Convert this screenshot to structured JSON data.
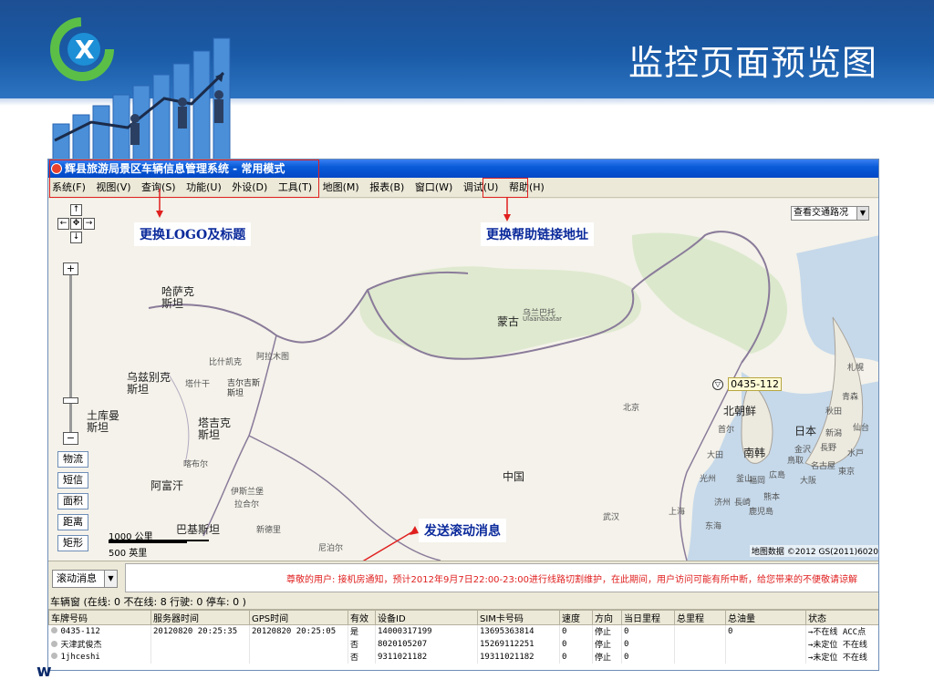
{
  "slide": {
    "title": "监控页面预览图",
    "corner_text": "w"
  },
  "app": {
    "window_title": "辉县旅游局景区车辆信息管理系统 - 常用模式",
    "menu": [
      "系统(F)",
      "视图(V)",
      "查询(S)",
      "功能(U)",
      "外设(D)",
      "工具(T)",
      "地图(M)",
      "报表(B)",
      "窗口(W)",
      "调试(U)",
      "帮助(H)"
    ]
  },
  "annotations": {
    "logo_title": "更换LOGO及标题",
    "help_link": "更换帮助链接地址",
    "scroll_msg": "发送滚动消息"
  },
  "map": {
    "traffic_select": "查看交通路况",
    "side_buttons": [
      "物流",
      "短信",
      "面积",
      "距离",
      "矩形"
    ],
    "scale": {
      "km": "1000 公里",
      "mi": "500 英里"
    },
    "copyright": "地图数据 ©2012 GS(2011)6020",
    "vehicle_marker": "0435-112",
    "labels": {
      "kazakhstan": "哈萨克\n斯坦",
      "uzbekistan": "乌兹别克\n斯坦",
      "turkmenistan": "土库曼\n斯坦",
      "tajikistan": "塔吉克\n斯坦",
      "afghanistan": "阿富汗",
      "pakistan": "巴基斯坦",
      "mongolia": "蒙古",
      "ulaanbaatar": "乌兰巴托",
      "ulaanbaatar_en": "Ulaanbaatar",
      "china": "中国",
      "north_korea": "北朝鲜",
      "south_korea": "南韩",
      "japan": "日本",
      "beijing": "北京",
      "shanghai": "上海",
      "wuhan": "武汉",
      "bishkek": "比什凯克",
      "almaty": "阿拉木图",
      "kyrgyzstan": "吉尔吉斯\n斯坦",
      "tashkent": "塔什干",
      "kabul": "喀布尔",
      "islamabad": "伊斯兰堡",
      "lahore": "拉合尔",
      "new_delhi": "新德里",
      "nepal": "尼泊尔",
      "east_sea": "东海",
      "sapporo": "札幌",
      "aomori": "青森",
      "akita": "秋田",
      "sendai": "仙台",
      "niigata": "新潟",
      "tokyo": "東京",
      "nagoya": "名古屋",
      "osaka": "大阪",
      "hiroshima": "広島",
      "fukuoka": "福岡",
      "kumamoto": "熊本",
      "kagoshima": "鹿児島",
      "nagasaki": "長崎",
      "busan": "釜山",
      "seoul": "首尔",
      "daejeon": "大田",
      "gwangju": "光州",
      "jeju": "济州",
      "tottori": "鳥取",
      "kanazawa": "金沢",
      "nagano": "長野",
      "mito": "水戸"
    }
  },
  "message_bar": {
    "combo_label": "滚动消息",
    "text": "尊敬的用户: 接机房通知，预计2012年9月7日22:00-23:00进行线路切割维护，在此期间，用户访问可能有所中断，给您带来的不便敬请谅解"
  },
  "vehicle_panel": {
    "status": "车辆窗    (在线:  0 不在线:  8 行驶:  0 停车:  0 )",
    "columns": [
      "车牌号码",
      "服务器时间",
      "GPS时间",
      "有效",
      "设备ID",
      "SIM卡号码",
      "速度",
      "方向",
      "当日里程",
      "总里程",
      "总油量",
      "状态"
    ],
    "rows": [
      [
        "0435-112",
        "20120820 20:25:35",
        "20120820 20:25:05",
        "是",
        "14000317199",
        "13695363814",
        "0",
        "停止",
        "0",
        "",
        "0",
        "→不在线 ACC点"
      ],
      [
        "天津武俊杰",
        "",
        "",
        "否",
        "8020105207",
        "15269112251",
        "0",
        "停止",
        "0",
        "",
        "",
        "→未定位 不在线"
      ],
      [
        "1jhceshi",
        "",
        "",
        "否",
        "9311021182",
        "19311021182",
        "0",
        "停止",
        "0",
        "",
        "",
        "→未定位 不在线"
      ]
    ]
  },
  "colors": {
    "header_blue": "#1a5aa6",
    "annotation_text": "#0b2a9b",
    "annotation_box": "#e02020",
    "message_text": "#e02020"
  }
}
